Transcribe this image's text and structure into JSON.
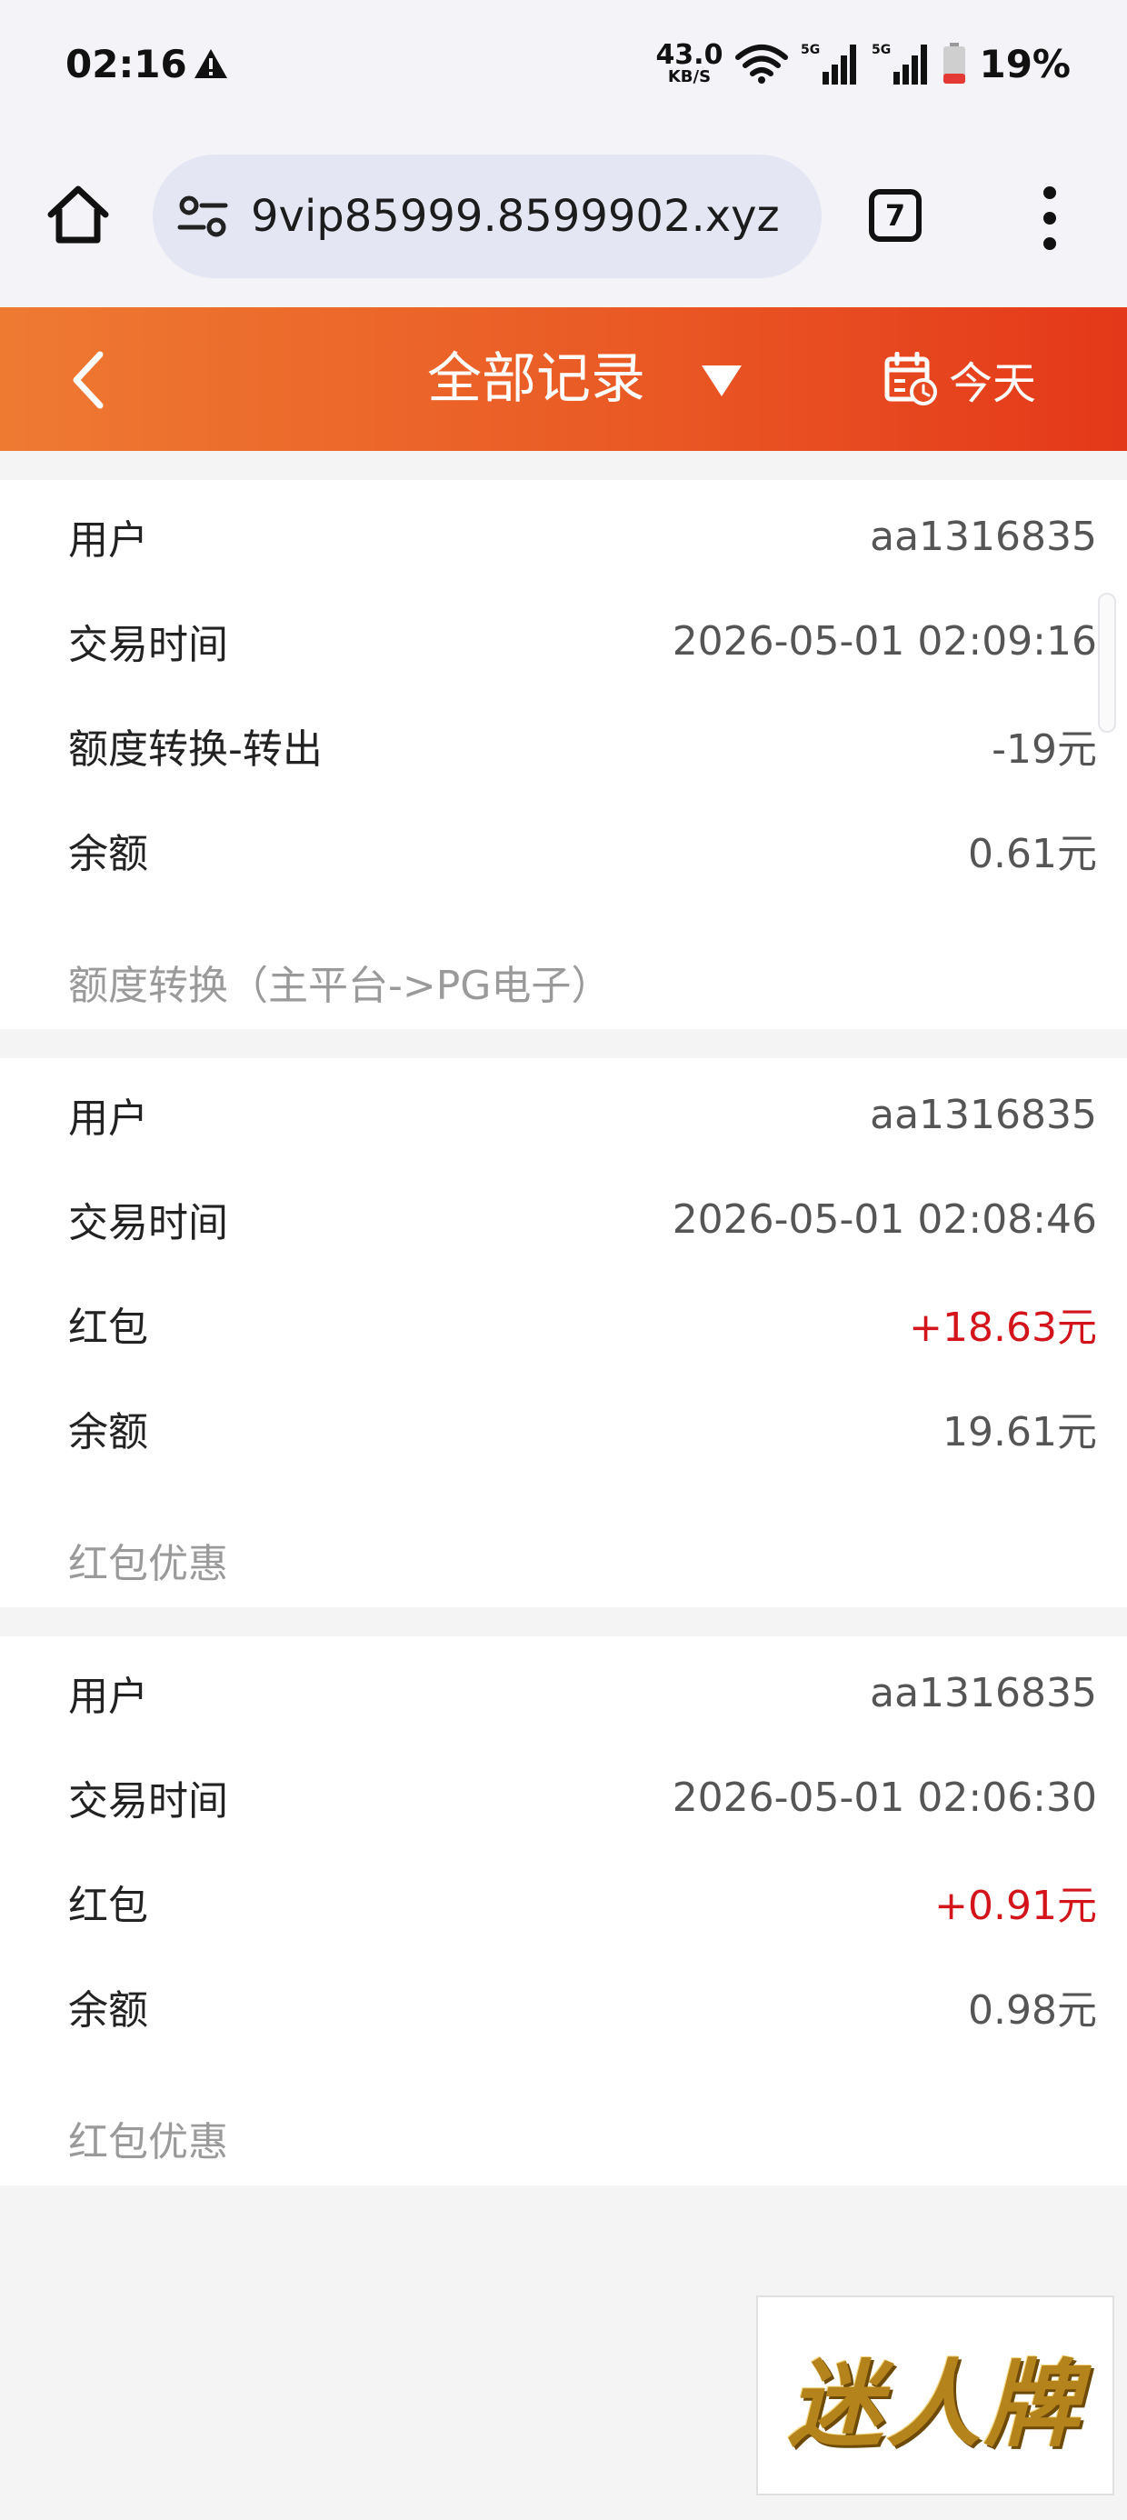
{
  "status_bar": {
    "time": "02:16",
    "net_speed_value": "43.0",
    "net_speed_unit": "KB/S",
    "battery": "19%"
  },
  "browser": {
    "url": "9vip85999.8599902.xyz",
    "tab_count": "7"
  },
  "header": {
    "title": "全部记录",
    "date_filter": "今天"
  },
  "records": [
    {
      "user_label": "用户",
      "user": "aa1316835",
      "time_label": "交易时间",
      "time": "2026-05-01 02:09:16",
      "type_label": "额度转换-转出",
      "amount": "-19元",
      "balance_label": "余额",
      "balance": "0.61元",
      "note": "额度转换（主平台->PG电子）"
    },
    {
      "user_label": "用户",
      "user": "aa1316835",
      "time_label": "交易时间",
      "time": "2026-05-01 02:08:46",
      "type_label": "红包",
      "amount": "+18.63元",
      "balance_label": "余额",
      "balance": "19.61元",
      "note": "红包优惠"
    },
    {
      "user_label": "用户",
      "user": "aa1316835",
      "time_label": "交易时间",
      "time": "2026-05-01 02:06:30",
      "type_label": "红包",
      "amount": "+0.91元",
      "balance_label": "余额",
      "balance": "0.98元",
      "note": "红包优惠"
    }
  ],
  "logo": {
    "text": "迷人牌"
  },
  "colors": {
    "header_start": "#ee7a32",
    "header_end": "#e4381a",
    "positive_amount": "#d3141b"
  },
  "icons": [
    "warning-icon",
    "wifi-icon",
    "signal-icon",
    "battery-icon",
    "home-icon",
    "tune-icon",
    "tabs-icon",
    "more-vert-icon",
    "back-icon",
    "caret-down-icon",
    "calendar-icon"
  ]
}
